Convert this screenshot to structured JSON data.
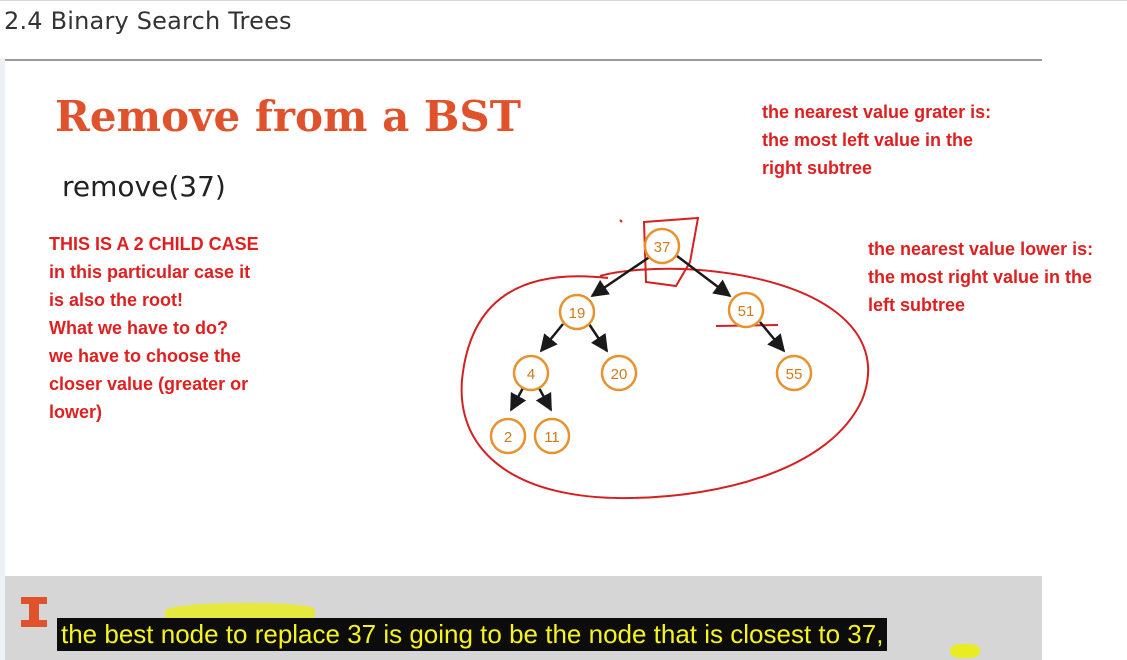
{
  "header": {
    "title": "2.4 Binary Search Trees"
  },
  "slide": {
    "title": "Remove from a BST",
    "operation": "remove(37)"
  },
  "annotations": {
    "left_note": [
      "THIS IS A 2 CHILD CASE",
      "in this particular case it",
      "is also the root!",
      "What we have to do?",
      "we have to choose the",
      "closer value (greater or",
      "lower)"
    ],
    "top_right_note": [
      "the nearest value grater is:",
      "the most left value in the",
      "right subtree"
    ],
    "right_note": [
      "the nearest value lower is:",
      "the most right value in the",
      "left subtree"
    ]
  },
  "tree": {
    "nodes": [
      "37",
      "19",
      "51",
      "4",
      "20",
      "55",
      "2",
      "11"
    ]
  },
  "caption": {
    "text": "the best node to replace 37 is going to be the node that is closest to 37,"
  },
  "colors": {
    "title": "#e0522b",
    "annotation": "#e02020",
    "node_border": "#e8922e",
    "caption_text": "#f7f31c",
    "caption_bg": "#0c0c0c"
  }
}
